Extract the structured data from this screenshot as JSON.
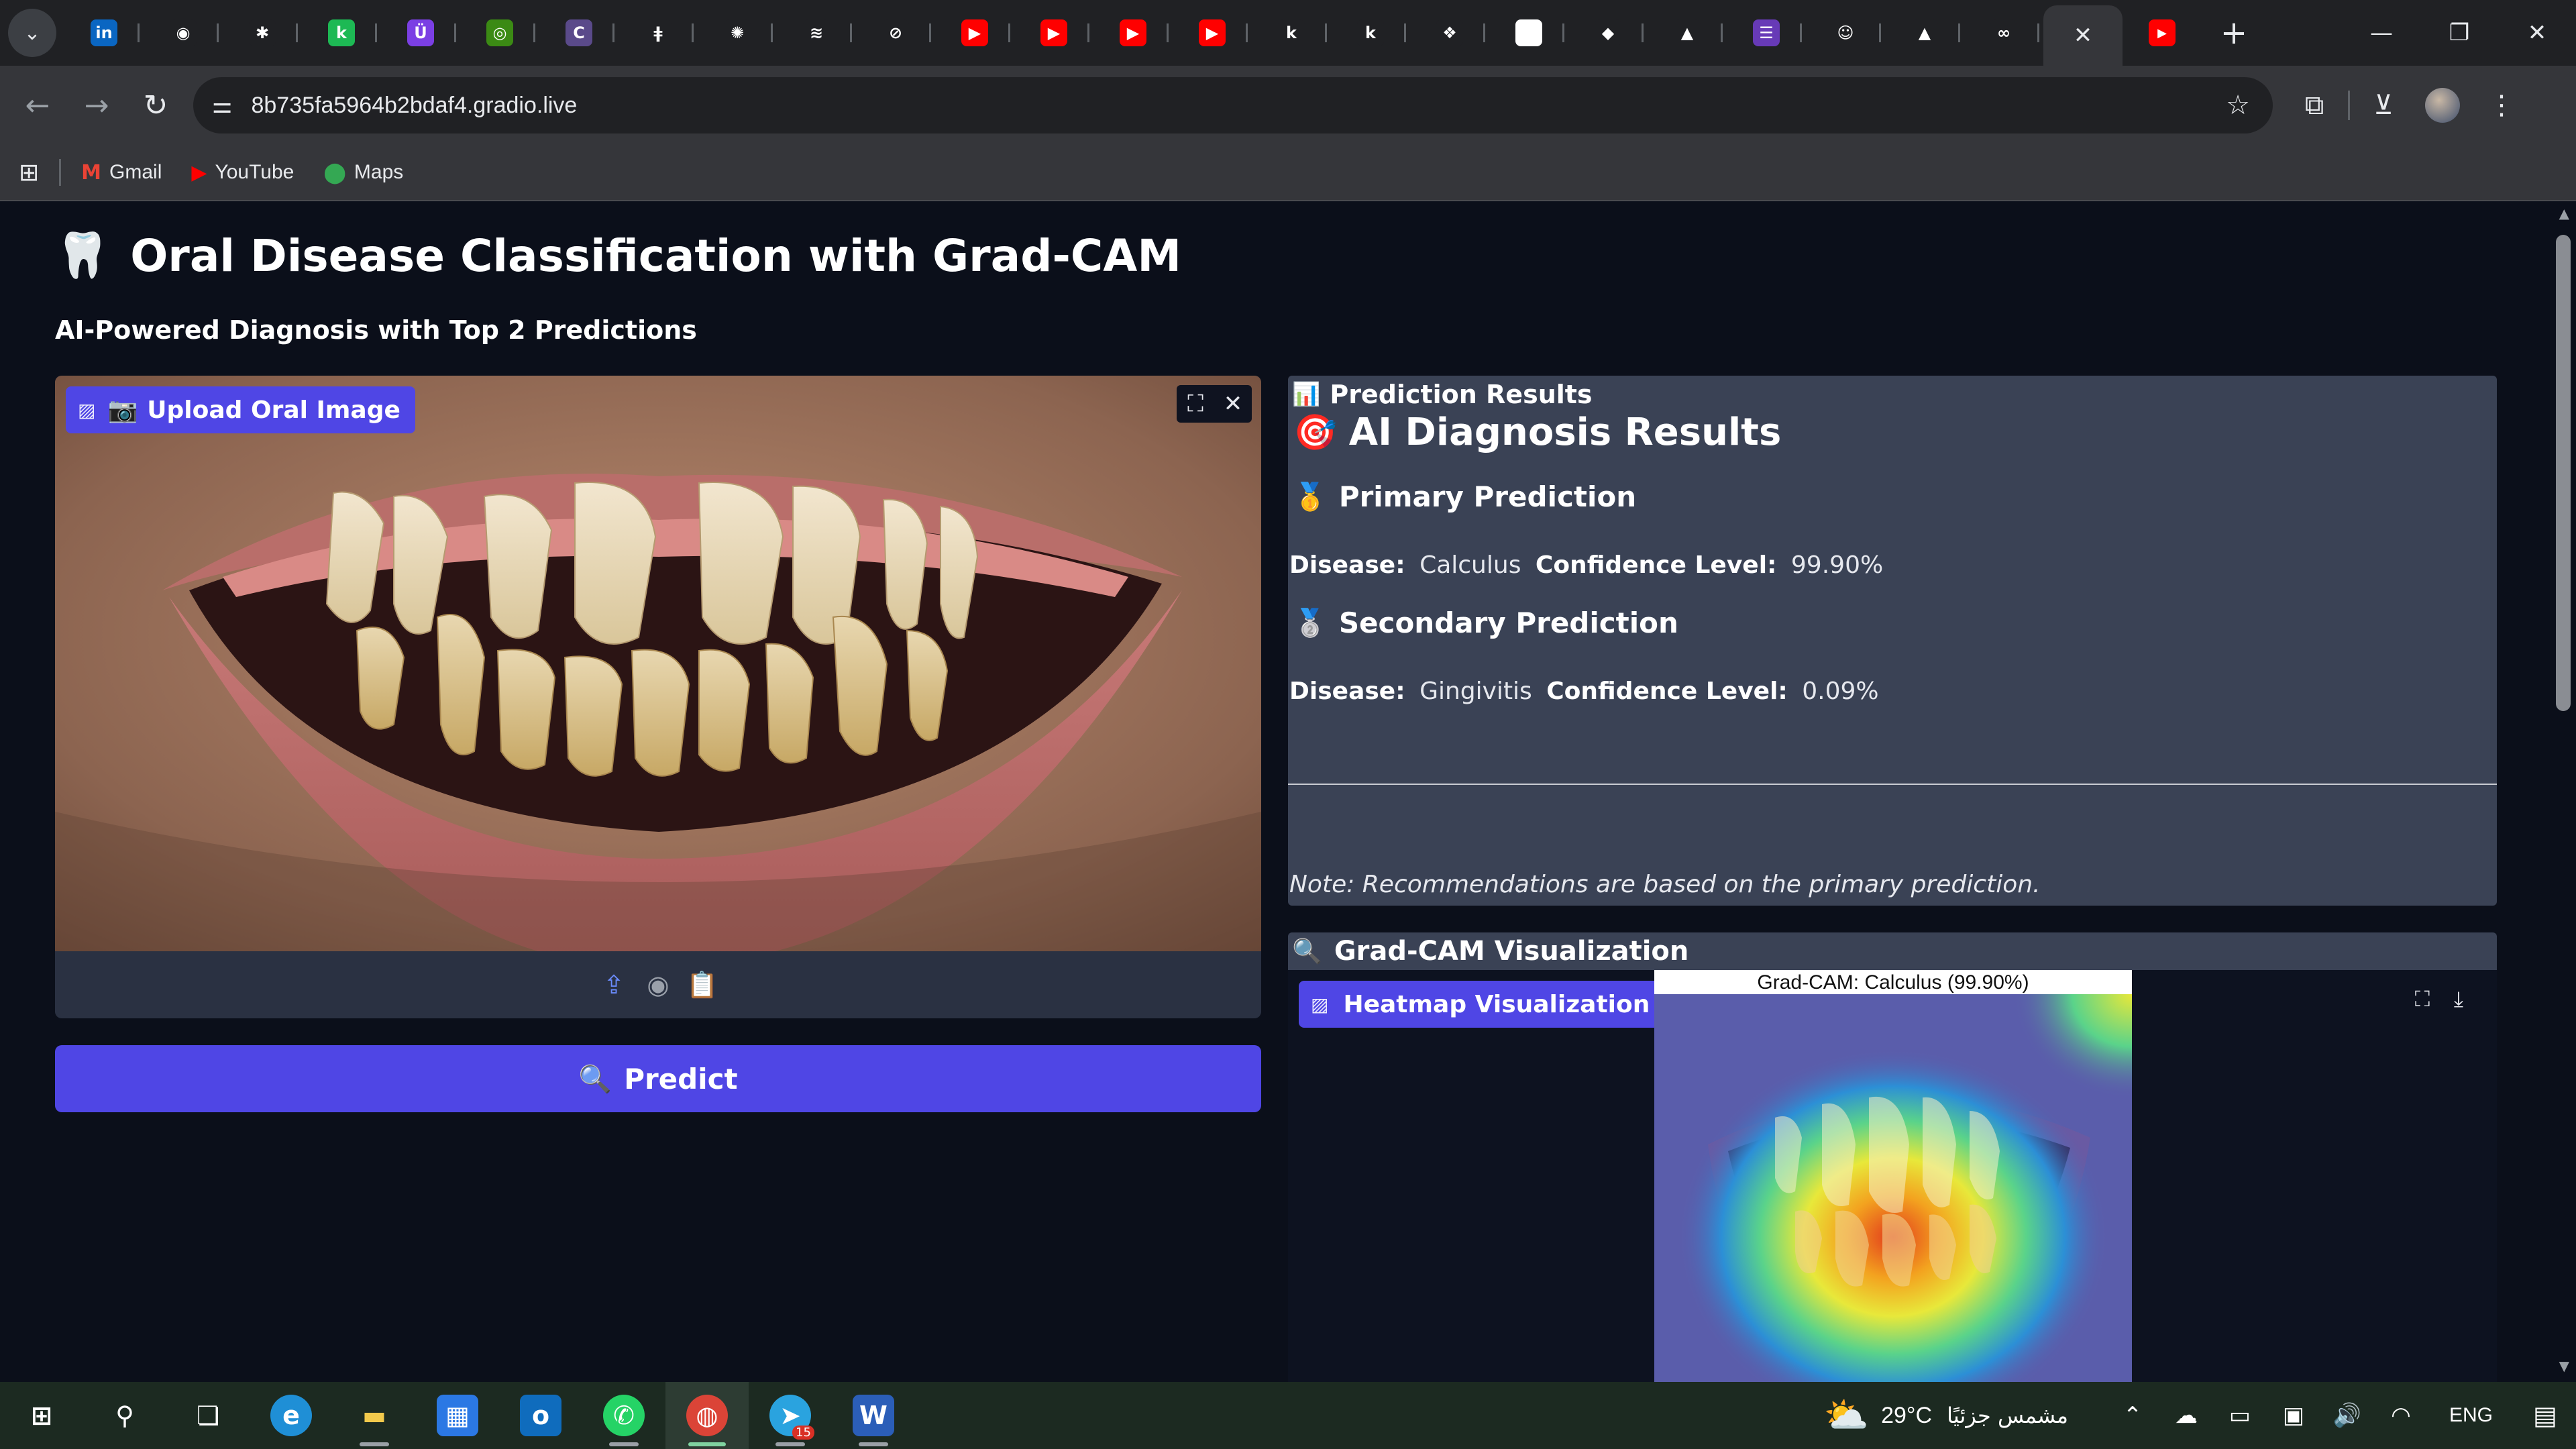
{
  "browser": {
    "url": "8b735fa5964b2bdaf4.gradio.live",
    "tabs": [
      {
        "icon": "linkedin-icon",
        "glyph": "in",
        "color": "#0a66c2"
      },
      {
        "icon": "github-icon",
        "glyph": "◉",
        "color": "#202124"
      },
      {
        "icon": "bug-icon",
        "glyph": "✱",
        "color": "#202124"
      },
      {
        "icon": "kaggle-green-icon",
        "glyph": "k",
        "color": "#1db954"
      },
      {
        "icon": "purple-u-icon",
        "glyph": "Ü",
        "color": "#7b3fe4"
      },
      {
        "icon": "nvidia-icon",
        "glyph": "◎",
        "color": "#3b8a14"
      },
      {
        "icon": "c-badge-icon",
        "glyph": "C",
        "color": "#5a4a8a"
      },
      {
        "icon": "candle-icon",
        "glyph": "ǂ",
        "color": "#202124"
      },
      {
        "icon": "openai-icon",
        "glyph": "✺",
        "color": "#202124"
      },
      {
        "icon": "stack-icon",
        "glyph": "≋",
        "color": "#202124"
      },
      {
        "icon": "slash-circle-icon",
        "glyph": "⊘",
        "color": "#202124"
      },
      {
        "icon": "youtube-icon",
        "glyph": "▶",
        "color": "#ff0000"
      },
      {
        "icon": "youtube-icon",
        "glyph": "▶",
        "color": "#ff0000"
      },
      {
        "icon": "youtube-icon",
        "glyph": "▶",
        "color": "#ff0000"
      },
      {
        "icon": "youtube-icon",
        "glyph": "▶",
        "color": "#ff0000"
      },
      {
        "icon": "kaggle-icon",
        "glyph": "k",
        "color": "#202124"
      },
      {
        "icon": "kaggle-icon",
        "glyph": "k",
        "color": "#202124"
      },
      {
        "icon": "swirl-icon",
        "glyph": "❖",
        "color": "#202124"
      },
      {
        "icon": "notion-icon",
        "glyph": "N",
        "color": "#ffffff"
      },
      {
        "icon": "eraser-icon",
        "glyph": "◆",
        "color": "#202124"
      },
      {
        "icon": "google-drive-icon",
        "glyph": "▲",
        "color": "#202124"
      },
      {
        "icon": "forms-icon",
        "glyph": "☰",
        "color": "#673ab7"
      },
      {
        "icon": "huggingface-icon",
        "glyph": "☺",
        "color": "#202124"
      },
      {
        "icon": "google-drive-icon",
        "glyph": "▲",
        "color": "#202124"
      },
      {
        "icon": "infinity-icon",
        "glyph": "∞",
        "color": "#202124"
      }
    ],
    "bookmarks": [
      {
        "label": "Gmail",
        "icon": "gmail-icon",
        "glyph": "M",
        "color": "#ea4335"
      },
      {
        "label": "YouTube",
        "icon": "youtube-icon",
        "glyph": "▶",
        "color": "#ff0000"
      },
      {
        "label": "Maps",
        "icon": "maps-icon",
        "glyph": "⬤",
        "color": "#34a853"
      }
    ]
  },
  "app": {
    "title_icon": "🦷",
    "title": "Oral Disease Classification with Grad-CAM",
    "subtitle": "AI-Powered Diagnosis with Top 2 Predictions",
    "upload": {
      "camera_glyph": "📷",
      "label": "Upload Oral Image"
    },
    "predict": {
      "icon_glyph": "🔍",
      "label": "Predict"
    },
    "results": {
      "header_icon": "📊",
      "header": "Prediction Results",
      "title_icon": "🎯",
      "title": "AI Diagnosis Results",
      "primary": {
        "icon": "🥇",
        "heading": "Primary Prediction",
        "disease_label": "Disease:",
        "disease": "Calculus",
        "confidence_label": "Confidence Level:",
        "confidence": "99.90%"
      },
      "secondary": {
        "icon": "🥈",
        "heading": "Secondary Prediction",
        "disease_label": "Disease:",
        "disease": "Gingivitis",
        "confidence_label": "Confidence Level:",
        "confidence": "0.09%"
      },
      "note": "Note: Recommendations are based on the primary prediction."
    },
    "gradcam": {
      "header_icon": "🔍",
      "header": "Grad-CAM Visualization",
      "label": "Heatmap Visualization",
      "image_caption": "Grad-CAM: Calculus (99.90%)"
    }
  },
  "taskbar": {
    "apps": [
      {
        "icon": "windows-start-icon"
      },
      {
        "icon": "search-icon"
      },
      {
        "icon": "task-view-icon"
      },
      {
        "icon": "edge-icon"
      },
      {
        "icon": "file-explorer-icon"
      },
      {
        "icon": "microsoft-store-icon"
      },
      {
        "icon": "outlook-icon"
      },
      {
        "icon": "whatsapp-icon"
      },
      {
        "icon": "chrome-icon"
      },
      {
        "icon": "telegram-icon",
        "badge": "15"
      },
      {
        "icon": "word-icon"
      }
    ],
    "weather": {
      "temp": "29°C",
      "desc": "مشمس جزئيًا"
    },
    "language": "ENG"
  },
  "colors": {
    "accent": "#4f46e5",
    "page_bg": "#0b0f1a",
    "panel_bg": "#3a4255"
  }
}
